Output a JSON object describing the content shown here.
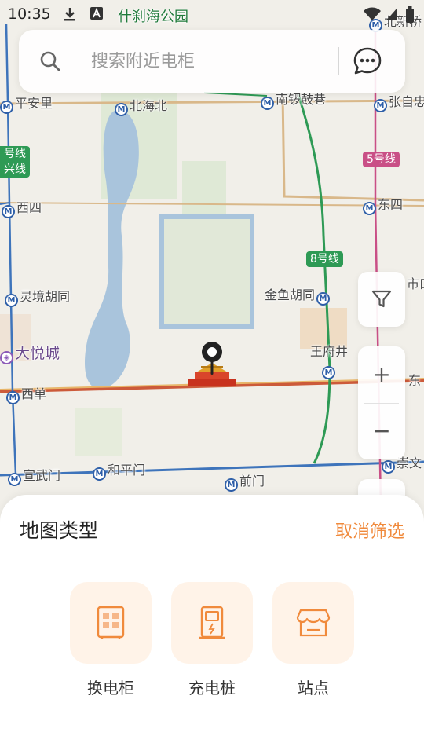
{
  "status_bar": {
    "time": "10:35",
    "icons": [
      "download-icon",
      "a-icon",
      "wifi-icon",
      "signal-icon",
      "battery-icon"
    ]
  },
  "search": {
    "placeholder": "搜索附近电柜",
    "icon": "search-icon",
    "chat_icon": "chat-bubble-icon"
  },
  "map": {
    "labels": {
      "shichahai": "什刹海公园",
      "beixin": "北新桥",
      "pinganli": "平安里",
      "beihaibei": "北海北",
      "nanluo": "南锣鼓巷",
      "zhangzi": "张自忠",
      "line4a": "号线",
      "line4b": "兴线",
      "xisi": "西四",
      "line5": "5号线",
      "dongsi": "东四",
      "line8": "8号线",
      "lingjing": "灵境胡同",
      "jinyu": "金鱼胡同",
      "shi": "市口",
      "dayuecheng": "大悦城",
      "wangfujing": "王府井",
      "xidan": "西单",
      "dong": "东",
      "xuanwu": "宣武门",
      "heping": "和平门",
      "qianmen": "前门",
      "chongwen": "崇文"
    }
  },
  "filter": {
    "icon": "funnel-icon"
  },
  "zoom": {
    "plus": "+",
    "minus": "−"
  },
  "sheet": {
    "title": "地图类型",
    "cancel": "取消筛选",
    "types": [
      {
        "label": "换电柜",
        "icon": "battery-cabinet-icon"
      },
      {
        "label": "充电桩",
        "icon": "charging-pile-icon"
      },
      {
        "label": "站点",
        "icon": "store-icon"
      }
    ]
  },
  "colors": {
    "accent": "#f08a3c",
    "tile_bg": "#fff3e8",
    "metro_blue": "#2d5ea8",
    "line5_pink": "#c94f86",
    "line8_green": "#2e9a55"
  }
}
